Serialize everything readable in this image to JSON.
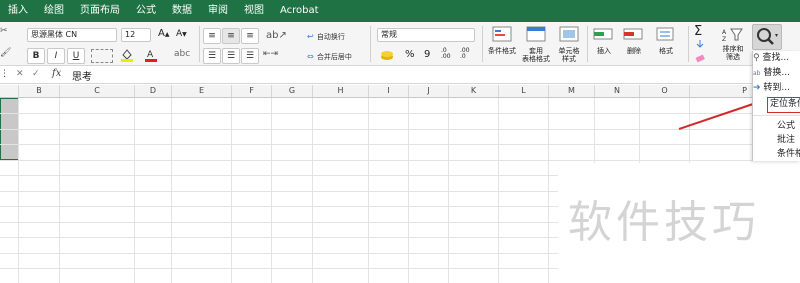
{
  "tabs": [
    "插入",
    "绘图",
    "页面布局",
    "公式",
    "数据",
    "审阅",
    "视图",
    "Acrobat"
  ],
  "font": {
    "name": "思源黑体 CN",
    "size": "12",
    "grow": "A",
    "shrink": "A"
  },
  "format_buttons": {
    "bold": "B",
    "italic": "I",
    "underline": "U"
  },
  "alignment": {
    "wrap_text": "自动换行",
    "merge_center": "合并后居中"
  },
  "number": {
    "format": "常规",
    "percent": "%",
    "comma": "9",
    "inc_decimal": ".0\n.00",
    "dec_decimal": ".00\n.0"
  },
  "styles": {
    "conditional": "条件格式",
    "table_line1": "套用",
    "table_line2": "表格格式",
    "cell_line1": "单元格",
    "cell_line2": "样式"
  },
  "cells": {
    "insert": "插入",
    "delete": "删除",
    "format": "格式"
  },
  "editing": {
    "sigma": "Σ",
    "sort_line1": "排序和",
    "sort_line2": "筛选"
  },
  "formula_bar": {
    "cancel": "✕",
    "enter": "✓",
    "fx": "fx",
    "content": "思考"
  },
  "columns": [
    "B",
    "C",
    "D",
    "E",
    "F",
    "G",
    "H",
    "I",
    "J",
    "K",
    "L",
    "M",
    "N",
    "O",
    "P"
  ],
  "menu": {
    "find": "查找...",
    "replace": "替换...",
    "goto": "转到...",
    "goto_special": "定位条件",
    "formulas": "公式",
    "comments": "批注",
    "cond_format": "条件格式"
  },
  "colors": {
    "ribbon_green": "#1f7244",
    "arrow_red": "#d22a2a",
    "selection_gray": "#c8c8c8",
    "font_color_red": "#e0201b",
    "fill_yellow": "#f7e600"
  },
  "watermark": "软件技巧"
}
